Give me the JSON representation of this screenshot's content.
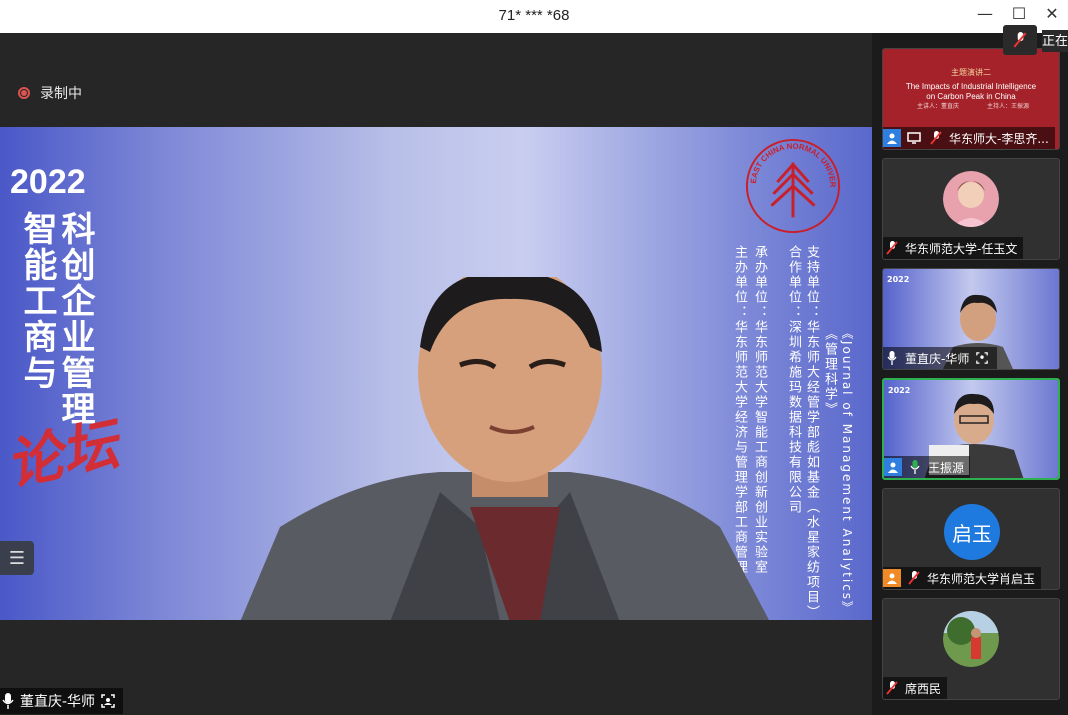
{
  "window": {
    "title": "71* *** *68",
    "minimize_glyph": "—",
    "maximize_glyph": "☐",
    "close_glyph": "✕"
  },
  "recording": {
    "label": "录制中"
  },
  "banner": {
    "year": "2022",
    "title_col1": "科创企业管理",
    "title_col2": "智能工商与",
    "forum": "论坛",
    "journal": "《Journal of Management Analytics》",
    "journal2": "《管理科学》",
    "support": "支持单位：华东师大经管学部彪如基金（水星家纺项目）",
    "coop": "合作单位：深圳希施玛数据科技有限公司",
    "undertake": "承办单位：华东师范大学智能工商创新创业实验室",
    "host": "主办单位：华东师范大学经济与管理学部工商管理学院",
    "logo_text": "EAST CHINA NORMAL UNIVERSITY"
  },
  "main_speaker": {
    "name": "董直庆-华师"
  },
  "top_right": {
    "label": "正在"
  },
  "participants": [
    {
      "name": "华东师大-李思齐...",
      "slide_title": "主题演讲二",
      "slide_text": "The Impacts of Industrial Intelligence on Carbon Peak in China",
      "slide_footer1": "主讲人：董直庆",
      "slide_footer2": "主持人：王振源"
    },
    {
      "name": "华东师范大学-任玉文"
    },
    {
      "name": "董直庆-华师",
      "mini_year": "2022"
    },
    {
      "name": "王振源",
      "mini_year": "2022"
    },
    {
      "name": "华东师范大学肖启玉",
      "avatar_text": "启玉"
    },
    {
      "name": "席西民"
    }
  ],
  "colors": {
    "accent_green": "#2fb050",
    "accent_blue": "#2f7fe0",
    "rec_red": "#d9534f"
  }
}
